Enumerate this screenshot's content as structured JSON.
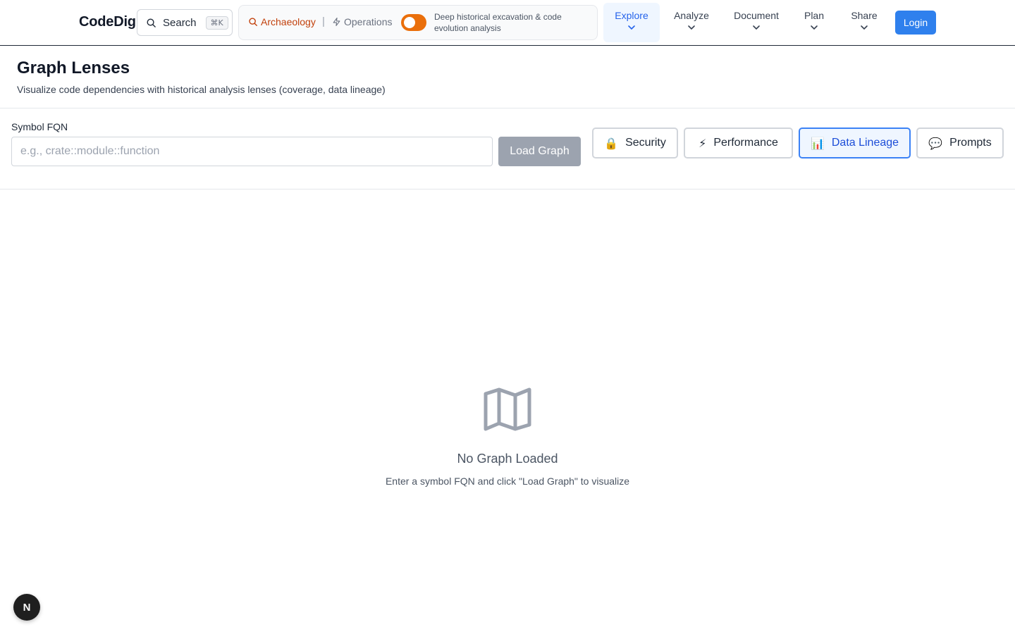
{
  "header": {
    "logo": "CodeDig",
    "search": {
      "label": "Search",
      "shortcut": "⌘K"
    },
    "mode": {
      "archaeology_label": "Archaeology",
      "separator": "|",
      "operations_label": "Operations",
      "toggle_on": true,
      "description": "Deep historical excavation & code evolution analysis"
    },
    "nav": [
      {
        "label": "Explore",
        "active": true
      },
      {
        "label": "Analyze",
        "active": false
      },
      {
        "label": "Document",
        "active": false
      },
      {
        "label": "Plan",
        "active": false
      },
      {
        "label": "Share",
        "active": false
      }
    ],
    "login_label": "Login"
  },
  "page": {
    "title": "Graph Lenses",
    "subtitle": "Visualize code dependencies with historical analysis lenses (coverage, data lineage)"
  },
  "controls": {
    "fqn_label": "Symbol FQN",
    "fqn_placeholder": "e.g., crate::module::function",
    "fqn_value": "",
    "load_button": "Load Graph",
    "lenses": [
      {
        "icon": "lock-icon",
        "emoji": "🔒",
        "label": "Security",
        "selected": false
      },
      {
        "icon": "lightning-icon",
        "emoji": "⚡",
        "label": "Performance",
        "selected": false
      },
      {
        "icon": "bar-chart-icon",
        "emoji": "📊",
        "label": "Data Lineage",
        "selected": true
      },
      {
        "icon": "speech-bubble-icon",
        "emoji": "💬",
        "label": "Prompts",
        "selected": false
      }
    ]
  },
  "empty_state": {
    "icon": "map-icon",
    "title": "No Graph Loaded",
    "hint": "Enter a symbol FQN and click \"Load Graph\" to visualize"
  },
  "dev_badge": {
    "letter": "N"
  },
  "colors": {
    "accent": "#2f80ed",
    "toggle": "#ea6f0b",
    "archaeology": "#c2410c",
    "active_nav_bg": "#eff6ff"
  }
}
